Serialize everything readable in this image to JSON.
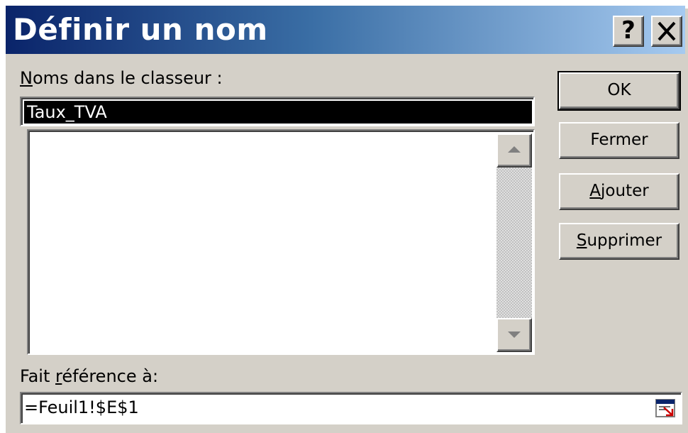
{
  "dialog": {
    "title": "Définir un nom",
    "help_label": "?",
    "close_label": "✕"
  },
  "names": {
    "label_prefix": "",
    "label_underlined": "N",
    "label_rest": "oms dans le classeur :",
    "current_value": "Taux_TVA",
    "items": []
  },
  "buttons": {
    "ok": "OK",
    "fermer": "Fermer",
    "ajouter_underlined": "A",
    "ajouter_rest": "jouter",
    "supprimer_underlined": "S",
    "supprimer_rest": "upprimer"
  },
  "reference": {
    "label_prefix": "Fait ",
    "label_underlined": "r",
    "label_rest": "éférence à:",
    "value": "=Feuil1!$E$1"
  },
  "icons": {
    "help": "help-icon",
    "close": "close-icon",
    "scroll_up": "scroll-up-arrow-icon",
    "scroll_down": "scroll-down-arrow-icon",
    "collapse_dialog": "collapse-dialog-icon"
  },
  "colors": {
    "title_start": "#0a246a",
    "title_end": "#a6caf0",
    "face": "#d4d0c8",
    "selection": "#000000"
  }
}
